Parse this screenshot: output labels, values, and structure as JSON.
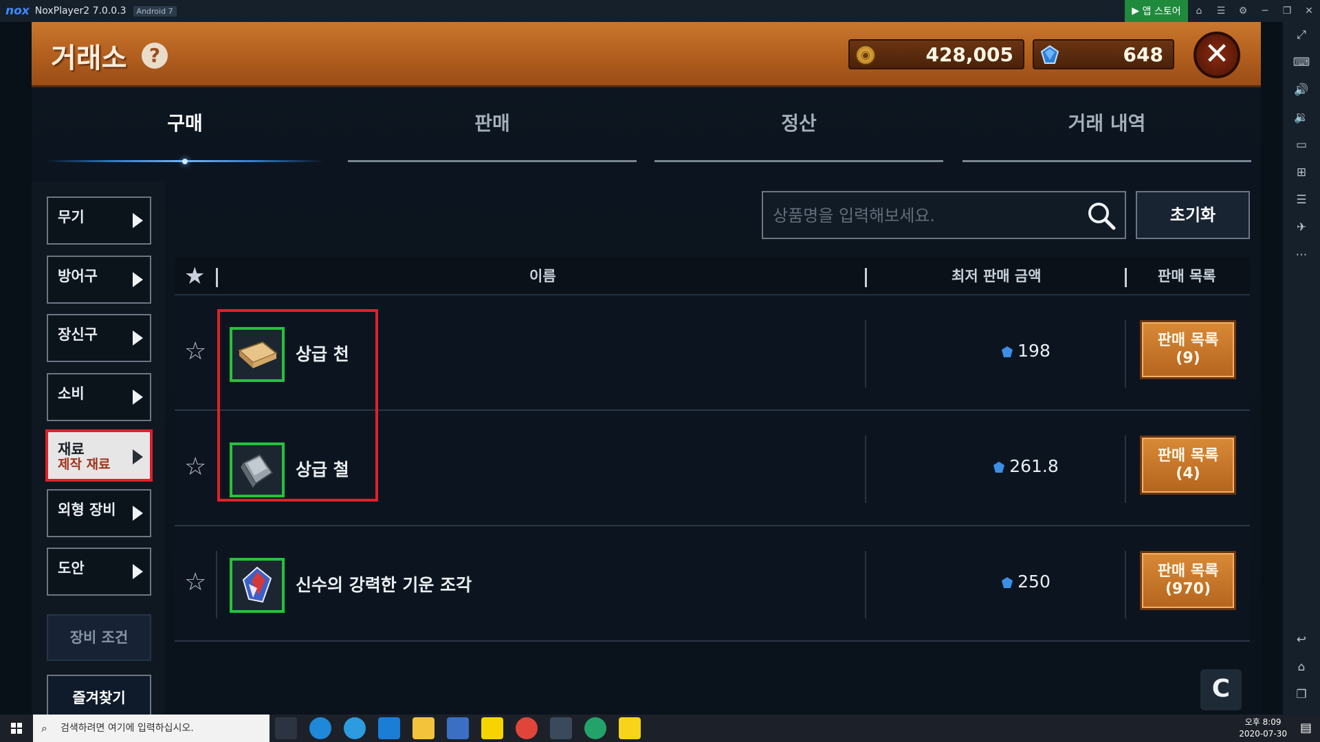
{
  "window": {
    "logo": "nox",
    "title": "NoxPlayer2 7.0.0.3",
    "android_badge": "Android 7",
    "appstore_label": "앱 스토어"
  },
  "header": {
    "title": "거래소",
    "help": "?",
    "gold": "428,005",
    "gems": "648",
    "close": "✕"
  },
  "tabs": [
    {
      "label": "구매",
      "active": true
    },
    {
      "label": "판매",
      "active": false
    },
    {
      "label": "정산",
      "active": false
    },
    {
      "label": "거래 내역",
      "active": false
    }
  ],
  "categories": [
    {
      "label": "무기"
    },
    {
      "label": "방어구"
    },
    {
      "label": "장신구"
    },
    {
      "label": "소비"
    },
    {
      "label": "재료",
      "sub": "제작 재료",
      "selected": true
    },
    {
      "label": "외형 장비"
    },
    {
      "label": "도안"
    }
  ],
  "equip_condition_label": "장비 조건",
  "favorites_label": "즐겨찾기",
  "search": {
    "placeholder": "상품명을 입력해보세요.",
    "reset_label": "초기화"
  },
  "table": {
    "columns": [
      "이름",
      "최저 판매 금액",
      "판매 목록"
    ],
    "rows": [
      {
        "name": "상급 천",
        "price": "198",
        "listing": "판매 목록",
        "count": "(9)"
      },
      {
        "name": "상급 철",
        "price": "261.8",
        "listing": "판매 목록",
        "count": "(4)"
      },
      {
        "name": "신수의 강력한 기운 조각",
        "price": "250",
        "listing": "판매 목록",
        "count": "(970)"
      }
    ]
  },
  "refresh": "C",
  "taskbar": {
    "search_placeholder": "검색하려면 여기에 입력하십시오.",
    "time": "오후 8:09",
    "date": "2020-07-30"
  },
  "colors": {
    "header_orange": "#b4601f",
    "highlight_red": "#e0202a",
    "item_border_green": "#25c23c",
    "active_tab_blue": "#6db6ff"
  }
}
